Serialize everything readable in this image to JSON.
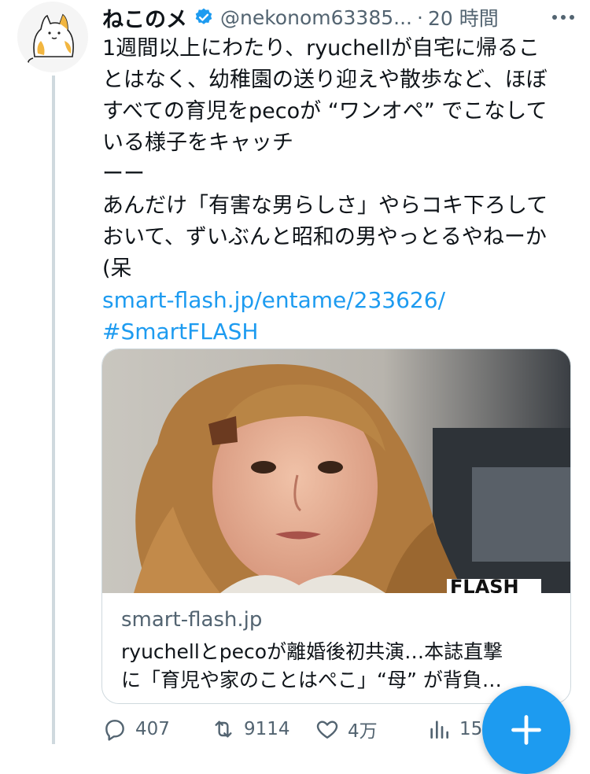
{
  "tweet": {
    "display_name": "ねこのメ",
    "handle": "@nekonom63385...",
    "separator": "·",
    "time": "20 時間",
    "body_lines": [
      "1週間以上にわたり、ryuchellが自宅に帰るこ",
      "とはなく、幼稚園の送り迎えや散歩など、ほぼ",
      "すべての育児をpecoが “ワンオペ” でこなして",
      "いる様子をキャッチ",
      "ーー",
      "あんだけ「有害な男らしさ」やらコキ下ろして",
      "おいて、ずいぶんと昭和の男やっとるやねーか",
      "(呆"
    ],
    "link_url": "smart-flash.jp/entame/233626/",
    "hashtag": "#SmartFLASH"
  },
  "card": {
    "domain": "smart-flash.jp",
    "title_lines": [
      "ryuchellとpecoが離婚後初共演…本誌直撃",
      "に「育児や家のことはぺこ」“母” が背負…"
    ],
    "image_watermark": "FLASH"
  },
  "actions": {
    "replies": "407",
    "retweets": "9114",
    "likes": "4万",
    "views": "15"
  },
  "colors": {
    "accent": "#1d9bf0",
    "secondary_text": "#536471",
    "border": "#cfd9de",
    "verified": "#1d9bf0"
  },
  "icons": {
    "verified": "verified-badge-icon",
    "more": "more-dots-icon",
    "reply": "reply-icon",
    "retweet": "retweet-icon",
    "like": "heart-icon",
    "views": "views-bars-icon",
    "compose": "plus-icon"
  }
}
